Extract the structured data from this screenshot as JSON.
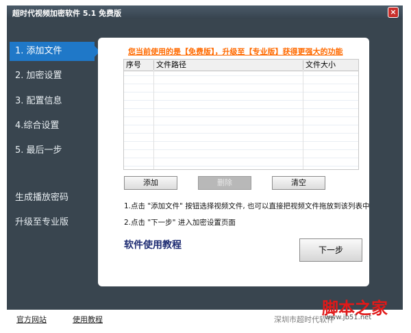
{
  "window": {
    "title": "超时代视频加密软件 5.1 免费版"
  },
  "sidebar": {
    "steps": [
      "1. 添加文件",
      "2. 加密设置",
      "3. 配置信息",
      "4.综合设置",
      "5. 最后一步"
    ],
    "extras": [
      "生成播放密码",
      "升级至专业版"
    ]
  },
  "main": {
    "promo_text": "您当前使用的是【免费版】，升级至【专业版】获得更强大的功能",
    "table": {
      "columns": [
        "序号",
        "文件路径",
        "文件大小"
      ],
      "rows": []
    },
    "buttons": {
      "add": "添加",
      "delete": "删除",
      "clear": "清空"
    },
    "hints": [
      "1.点击 \"添加文件\" 按钮选择视频文件, 也可以直接把视频文件拖放到该列表中",
      "2.点击 \"下一步\" 进入加密设置页面"
    ],
    "tutorial": "软件使用教程",
    "next": "下一步"
  },
  "footer": {
    "links": [
      "官方网站",
      "使用教程"
    ],
    "company": "深圳市超时代软件"
  },
  "watermark": {
    "text": "脚本之家",
    "url": "www.jb51.net"
  },
  "colors": {
    "frame": "#39454f",
    "active": "#1f78c8",
    "promo": "#ff6a00",
    "tutorial": "#1d2b72"
  }
}
